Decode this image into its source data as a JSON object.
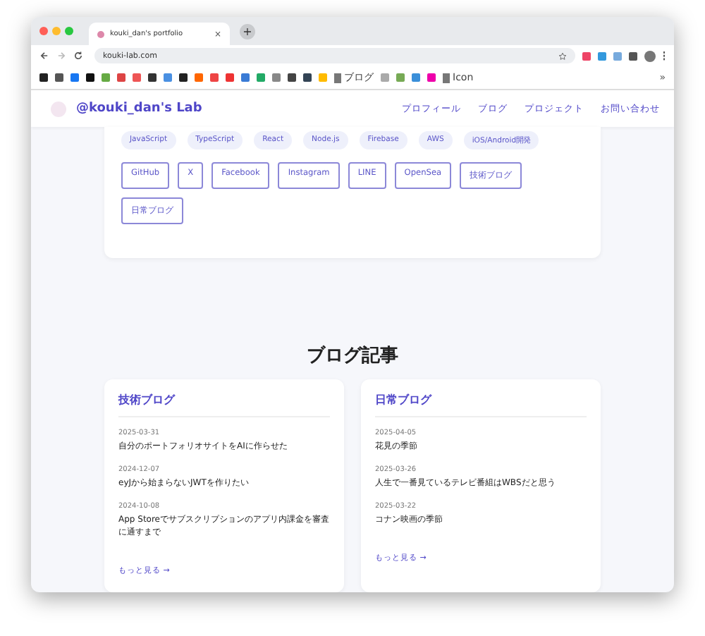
{
  "browser": {
    "tab_title": "kouki_dan's portfolio",
    "tab_close": "×",
    "new_tab": "+",
    "url": "kouki-lab.com",
    "bookmark_folders": [
      "ブログ",
      "Icon"
    ],
    "more": "»"
  },
  "header": {
    "logo": "@kouki_dan's Lab",
    "nav": [
      "プロフィール",
      "ブログ",
      "プロジェクト",
      "お問い合わせ"
    ]
  },
  "skills": [
    "JavaScript",
    "TypeScript",
    "React",
    "Node.js",
    "Firebase",
    "AWS",
    "iOS/Android開発"
  ],
  "links": [
    "GitHub",
    "X",
    "Facebook",
    "Instagram",
    "LINE",
    "OpenSea",
    "技術ブログ",
    "日常ブログ"
  ],
  "blog": {
    "title": "ブログ記事",
    "columns": [
      {
        "title": "技術ブログ",
        "posts": [
          {
            "date": "2025-03-31",
            "title": "自分のポートフォリオサイトをAIに作らせた"
          },
          {
            "date": "2024-12-07",
            "title": "eyJから始まらないJWTを作りたい"
          },
          {
            "date": "2024-10-08",
            "title": "App Storeでサブスクリプションのアプリ内課金を審査に通すまで"
          }
        ],
        "more": "もっと見る →"
      },
      {
        "title": "日常ブログ",
        "posts": [
          {
            "date": "2025-04-05",
            "title": "花見の季節"
          },
          {
            "date": "2025-03-26",
            "title": "人生で一番見ているテレビ番組はWBSだと思う"
          },
          {
            "date": "2025-03-22",
            "title": "コナン映画の季節"
          }
        ],
        "more": "もっと見る →"
      }
    ]
  }
}
